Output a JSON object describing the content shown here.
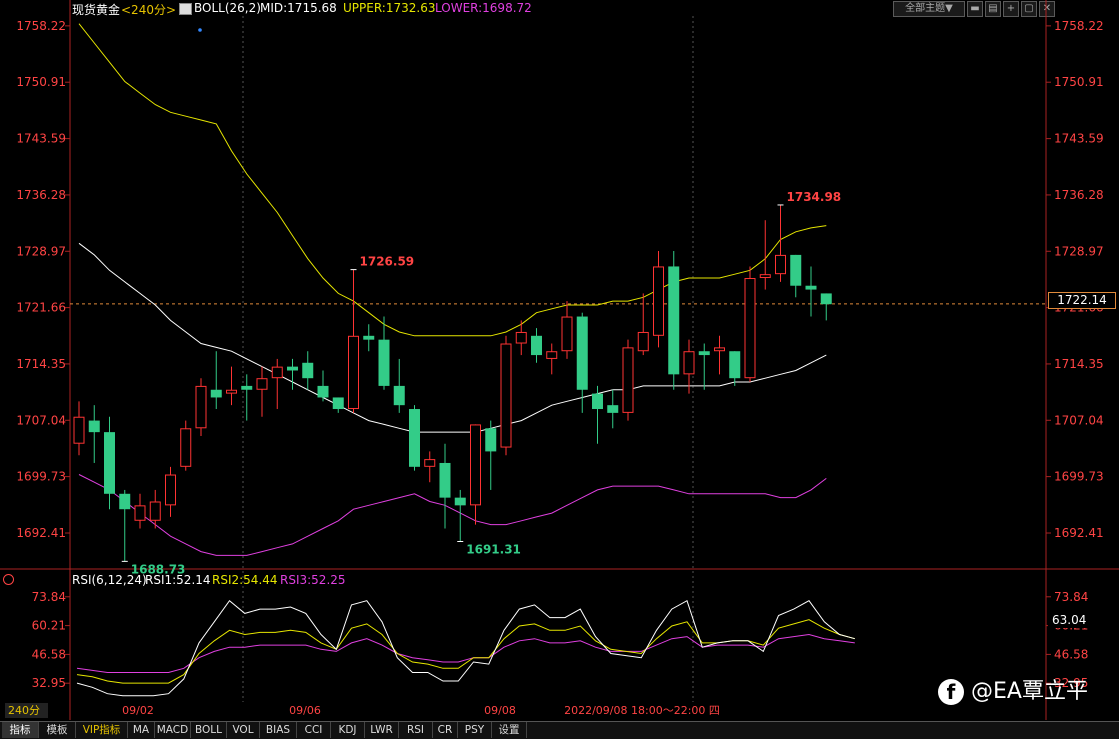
{
  "header": {
    "symbol": "现货黄金",
    "period": "<240分>",
    "indicator": "BOLL(26,2)",
    "mid": "MID:1715.68",
    "upper": "UPPER:1732.63",
    "lower": "LOWER:1698.72",
    "theme_button": "全部主题▼"
  },
  "rsi_header": {
    "name": "RSI(6,12,24)",
    "rsi1": "RSI1:52.14",
    "rsi2": "RSI2:54.44",
    "rsi3": "RSI3:52.25"
  },
  "current_price_label": "1722.14",
  "rsi_current_label": "63.04",
  "crosshair_time": "2022/09/08 18:00～22:00 四",
  "period_box": "240分",
  "bottom_tabs": [
    "指标",
    "模板",
    "VIP指标",
    "MA",
    "MACD",
    "BOLL",
    "VOL",
    "BIAS",
    "CCI",
    "KDJ",
    "LWR",
    "RSI",
    "CR",
    "PSY",
    "设置"
  ],
  "watermark": "@EA覃立平",
  "colors": {
    "up": "#ff3333",
    "down": "#33cc88",
    "boll_mid": "#ffffff",
    "boll_upper": "#e6e600",
    "boll_lower": "#e040e0",
    "rsi1": "#ffffff",
    "rsi2": "#e6e600",
    "rsi3": "#e040e0"
  },
  "chart_data": [
    {
      "type": "candlestick",
      "yticks": [
        "1758.22",
        "1750.91",
        "1743.59",
        "1736.28",
        "1728.97",
        "1721.66",
        "1714.35",
        "1707.04",
        "1699.73",
        "1692.41"
      ],
      "ylim": [
        1688.0,
        1759.5
      ],
      "xticks": [
        "09/02",
        "09/06",
        "09/08"
      ],
      "annotations": [
        {
          "text": "1688.73",
          "kind": "low"
        },
        {
          "text": "1726.59",
          "kind": "high"
        },
        {
          "text": "1691.31",
          "kind": "low"
        },
        {
          "text": "1734.98",
          "kind": "high"
        }
      ],
      "candles": [
        {
          "o": 1704.0,
          "c": 1707.5,
          "h": 1709.5,
          "l": 1702.5
        },
        {
          "o": 1707.0,
          "c": 1705.5,
          "h": 1709.0,
          "l": 1701.5
        },
        {
          "o": 1705.5,
          "c": 1697.5,
          "h": 1707.5,
          "l": 1695.5
        },
        {
          "o": 1697.5,
          "c": 1695.5,
          "h": 1698.0,
          "l": 1688.7
        },
        {
          "o": 1694.0,
          "c": 1696.0,
          "h": 1697.5,
          "l": 1693.0
        },
        {
          "o": 1694.0,
          "c": 1696.5,
          "h": 1698.0,
          "l": 1693.0
        },
        {
          "o": 1696.0,
          "c": 1700.0,
          "h": 1701.0,
          "l": 1694.5
        },
        {
          "o": 1701.0,
          "c": 1706.0,
          "h": 1707.0,
          "l": 1700.5
        },
        {
          "o": 1706.0,
          "c": 1711.5,
          "h": 1712.5,
          "l": 1705.0
        },
        {
          "o": 1711.0,
          "c": 1710.0,
          "h": 1716.0,
          "l": 1708.5
        },
        {
          "o": 1710.5,
          "c": 1711.0,
          "h": 1714.0,
          "l": 1709.0
        },
        {
          "o": 1711.5,
          "c": 1711.0,
          "h": 1713.0,
          "l": 1707.0
        },
        {
          "o": 1711.0,
          "c": 1712.5,
          "h": 1714.0,
          "l": 1707.5
        },
        {
          "o": 1712.5,
          "c": 1714.0,
          "h": 1715.0,
          "l": 1708.5
        },
        {
          "o": 1714.0,
          "c": 1713.5,
          "h": 1715.0,
          "l": 1711.0
        },
        {
          "o": 1714.5,
          "c": 1712.5,
          "h": 1716.0,
          "l": 1711.0
        },
        {
          "o": 1711.5,
          "c": 1710.0,
          "h": 1713.5,
          "l": 1709.5
        },
        {
          "o": 1710.0,
          "c": 1708.5,
          "h": 1710.0,
          "l": 1708.0
        },
        {
          "o": 1708.5,
          "c": 1718.0,
          "h": 1726.6,
          "l": 1708.0
        },
        {
          "o": 1718.0,
          "c": 1717.5,
          "h": 1719.5,
          "l": 1716.0
        },
        {
          "o": 1717.5,
          "c": 1711.5,
          "h": 1720.5,
          "l": 1711.0
        },
        {
          "o": 1711.5,
          "c": 1709.0,
          "h": 1715.0,
          "l": 1708.0
        },
        {
          "o": 1708.5,
          "c": 1701.0,
          "h": 1709.0,
          "l": 1700.5
        },
        {
          "o": 1701.0,
          "c": 1702.0,
          "h": 1703.0,
          "l": 1699.0
        },
        {
          "o": 1701.5,
          "c": 1697.0,
          "h": 1704.0,
          "l": 1693.0
        },
        {
          "o": 1697.0,
          "c": 1696.0,
          "h": 1698.0,
          "l": 1691.3
        },
        {
          "o": 1696.0,
          "c": 1706.5,
          "h": 1706.5,
          "l": 1693.5
        },
        {
          "o": 1706.0,
          "c": 1703.0,
          "h": 1707.0,
          "l": 1698.0
        },
        {
          "o": 1703.5,
          "c": 1717.0,
          "h": 1718.0,
          "l": 1702.5
        },
        {
          "o": 1717.0,
          "c": 1718.5,
          "h": 1720.0,
          "l": 1715.5
        },
        {
          "o": 1718.0,
          "c": 1715.5,
          "h": 1719.0,
          "l": 1714.5
        },
        {
          "o": 1715.0,
          "c": 1716.0,
          "h": 1717.0,
          "l": 1713.0
        },
        {
          "o": 1716.0,
          "c": 1720.5,
          "h": 1722.5,
          "l": 1715.0
        },
        {
          "o": 1720.5,
          "c": 1711.0,
          "h": 1721.0,
          "l": 1708.0
        },
        {
          "o": 1710.5,
          "c": 1708.5,
          "h": 1711.5,
          "l": 1704.0
        },
        {
          "o": 1709.0,
          "c": 1708.0,
          "h": 1711.0,
          "l": 1706.0
        },
        {
          "o": 1708.0,
          "c": 1716.5,
          "h": 1717.5,
          "l": 1707.0
        },
        {
          "o": 1716.0,
          "c": 1718.5,
          "h": 1723.5,
          "l": 1715.5
        },
        {
          "o": 1718.0,
          "c": 1727.0,
          "h": 1729.0,
          "l": 1716.5
        },
        {
          "o": 1727.0,
          "c": 1713.0,
          "h": 1729.0,
          "l": 1711.0
        },
        {
          "o": 1713.0,
          "c": 1716.0,
          "h": 1717.5,
          "l": 1710.5
        },
        {
          "o": 1716.0,
          "c": 1715.5,
          "h": 1717.0,
          "l": 1711.0
        },
        {
          "o": 1716.0,
          "c": 1716.5,
          "h": 1718.0,
          "l": 1713.0
        },
        {
          "o": 1716.0,
          "c": 1712.5,
          "h": 1716.0,
          "l": 1711.5
        },
        {
          "o": 1712.5,
          "c": 1725.5,
          "h": 1727.0,
          "l": 1712.0
        },
        {
          "o": 1725.5,
          "c": 1726.0,
          "h": 1733.0,
          "l": 1724.0
        },
        {
          "o": 1726.0,
          "c": 1728.5,
          "h": 1735.0,
          "l": 1725.0
        },
        {
          "o": 1728.5,
          "c": 1724.5,
          "h": 1728.5,
          "l": 1723.0
        },
        {
          "o": 1724.5,
          "c": 1724.0,
          "h": 1727.0,
          "l": 1720.5
        },
        {
          "o": 1723.5,
          "c": 1722.1,
          "h": 1723.5,
          "l": 1720.0
        }
      ],
      "boll_upper": [
        1758.5,
        1756.0,
        1753.5,
        1751.0,
        1749.5,
        1748.0,
        1747.0,
        1746.5,
        1746.0,
        1745.5,
        1742.0,
        1739.0,
        1736.5,
        1734.0,
        1731.0,
        1728.0,
        1725.5,
        1723.5,
        1722.5,
        1721.0,
        1719.5,
        1718.5,
        1718.0,
        1718.0,
        1718.0,
        1718.0,
        1718.0,
        1718.0,
        1718.5,
        1719.5,
        1721.0,
        1721.5,
        1722.0,
        1722.0,
        1722.0,
        1722.5,
        1722.5,
        1723.0,
        1724.0,
        1725.0,
        1725.5,
        1725.5,
        1725.5,
        1726.0,
        1726.5,
        1728.0,
        1730.5,
        1731.5,
        1732.0,
        1732.3
      ],
      "boll_mid": [
        1730.0,
        1728.5,
        1726.5,
        1725.0,
        1723.5,
        1722.0,
        1720.0,
        1718.5,
        1717.0,
        1716.5,
        1716.0,
        1715.0,
        1714.0,
        1713.0,
        1712.0,
        1711.0,
        1710.0,
        1709.0,
        1708.0,
        1707.0,
        1706.5,
        1706.0,
        1705.5,
        1705.5,
        1705.5,
        1705.5,
        1705.5,
        1706.0,
        1706.5,
        1707.0,
        1708.0,
        1709.0,
        1709.5,
        1710.0,
        1710.5,
        1711.0,
        1711.0,
        1711.5,
        1711.5,
        1711.5,
        1711.5,
        1711.5,
        1711.5,
        1712.0,
        1712.0,
        1712.5,
        1713.0,
        1713.5,
        1714.5,
        1715.5
      ],
      "boll_lower": [
        1700.0,
        1699.0,
        1698.0,
        1696.5,
        1695.0,
        1693.5,
        1692.0,
        1691.0,
        1690.0,
        1689.5,
        1689.5,
        1689.5,
        1690.0,
        1690.5,
        1691.0,
        1692.0,
        1693.0,
        1694.0,
        1695.5,
        1696.0,
        1696.5,
        1697.0,
        1697.5,
        1696.5,
        1696.0,
        1695.0,
        1694.0,
        1693.5,
        1693.5,
        1694.0,
        1694.5,
        1695.0,
        1696.0,
        1697.0,
        1698.0,
        1698.5,
        1698.5,
        1698.5,
        1698.5,
        1698.0,
        1697.5,
        1697.5,
        1697.5,
        1697.5,
        1697.5,
        1697.5,
        1697.0,
        1697.0,
        1698.0,
        1699.5
      ]
    },
    {
      "type": "line",
      "title": "RSI(6,12,24)",
      "yticks": [
        "73.84",
        "60.21",
        "46.58",
        "32.95"
      ],
      "ylim": [
        25.0,
        78.0
      ],
      "series": [
        {
          "name": "RSI1",
          "values": [
            33,
            31,
            28,
            27,
            27,
            27,
            28,
            35,
            52,
            62,
            72,
            66,
            68,
            68,
            69,
            66,
            56,
            49,
            70,
            72,
            62,
            45,
            38,
            38,
            34,
            34,
            43,
            42,
            58,
            68,
            70,
            64,
            64,
            68,
            55,
            47,
            46,
            45,
            58,
            68,
            72,
            50,
            52,
            53,
            53,
            48,
            65,
            68,
            72,
            62,
            56,
            54
          ]
        },
        {
          "name": "RSI2",
          "values": [
            37,
            36,
            34,
            33,
            33,
            33,
            33,
            37,
            47,
            53,
            58,
            56,
            57,
            57,
            58,
            57,
            52,
            49,
            59,
            61,
            56,
            47,
            43,
            42,
            40,
            40,
            45,
            45,
            54,
            60,
            61,
            58,
            58,
            60,
            53,
            49,
            48,
            47,
            54,
            60,
            62,
            52,
            52,
            53,
            53,
            51,
            59,
            61,
            63,
            59,
            56,
            54
          ]
        },
        {
          "name": "RSI3",
          "values": [
            40,
            39,
            38,
            38,
            38,
            38,
            38,
            40,
            45,
            48,
            50,
            50,
            51,
            51,
            51,
            51,
            49,
            48,
            52,
            54,
            51,
            47,
            45,
            44,
            43,
            43,
            45,
            45,
            50,
            53,
            54,
            52,
            52,
            53,
            50,
            48,
            48,
            48,
            51,
            54,
            55,
            50,
            51,
            51,
            51,
            50,
            54,
            55,
            56,
            54,
            53,
            52
          ]
        }
      ]
    }
  ]
}
